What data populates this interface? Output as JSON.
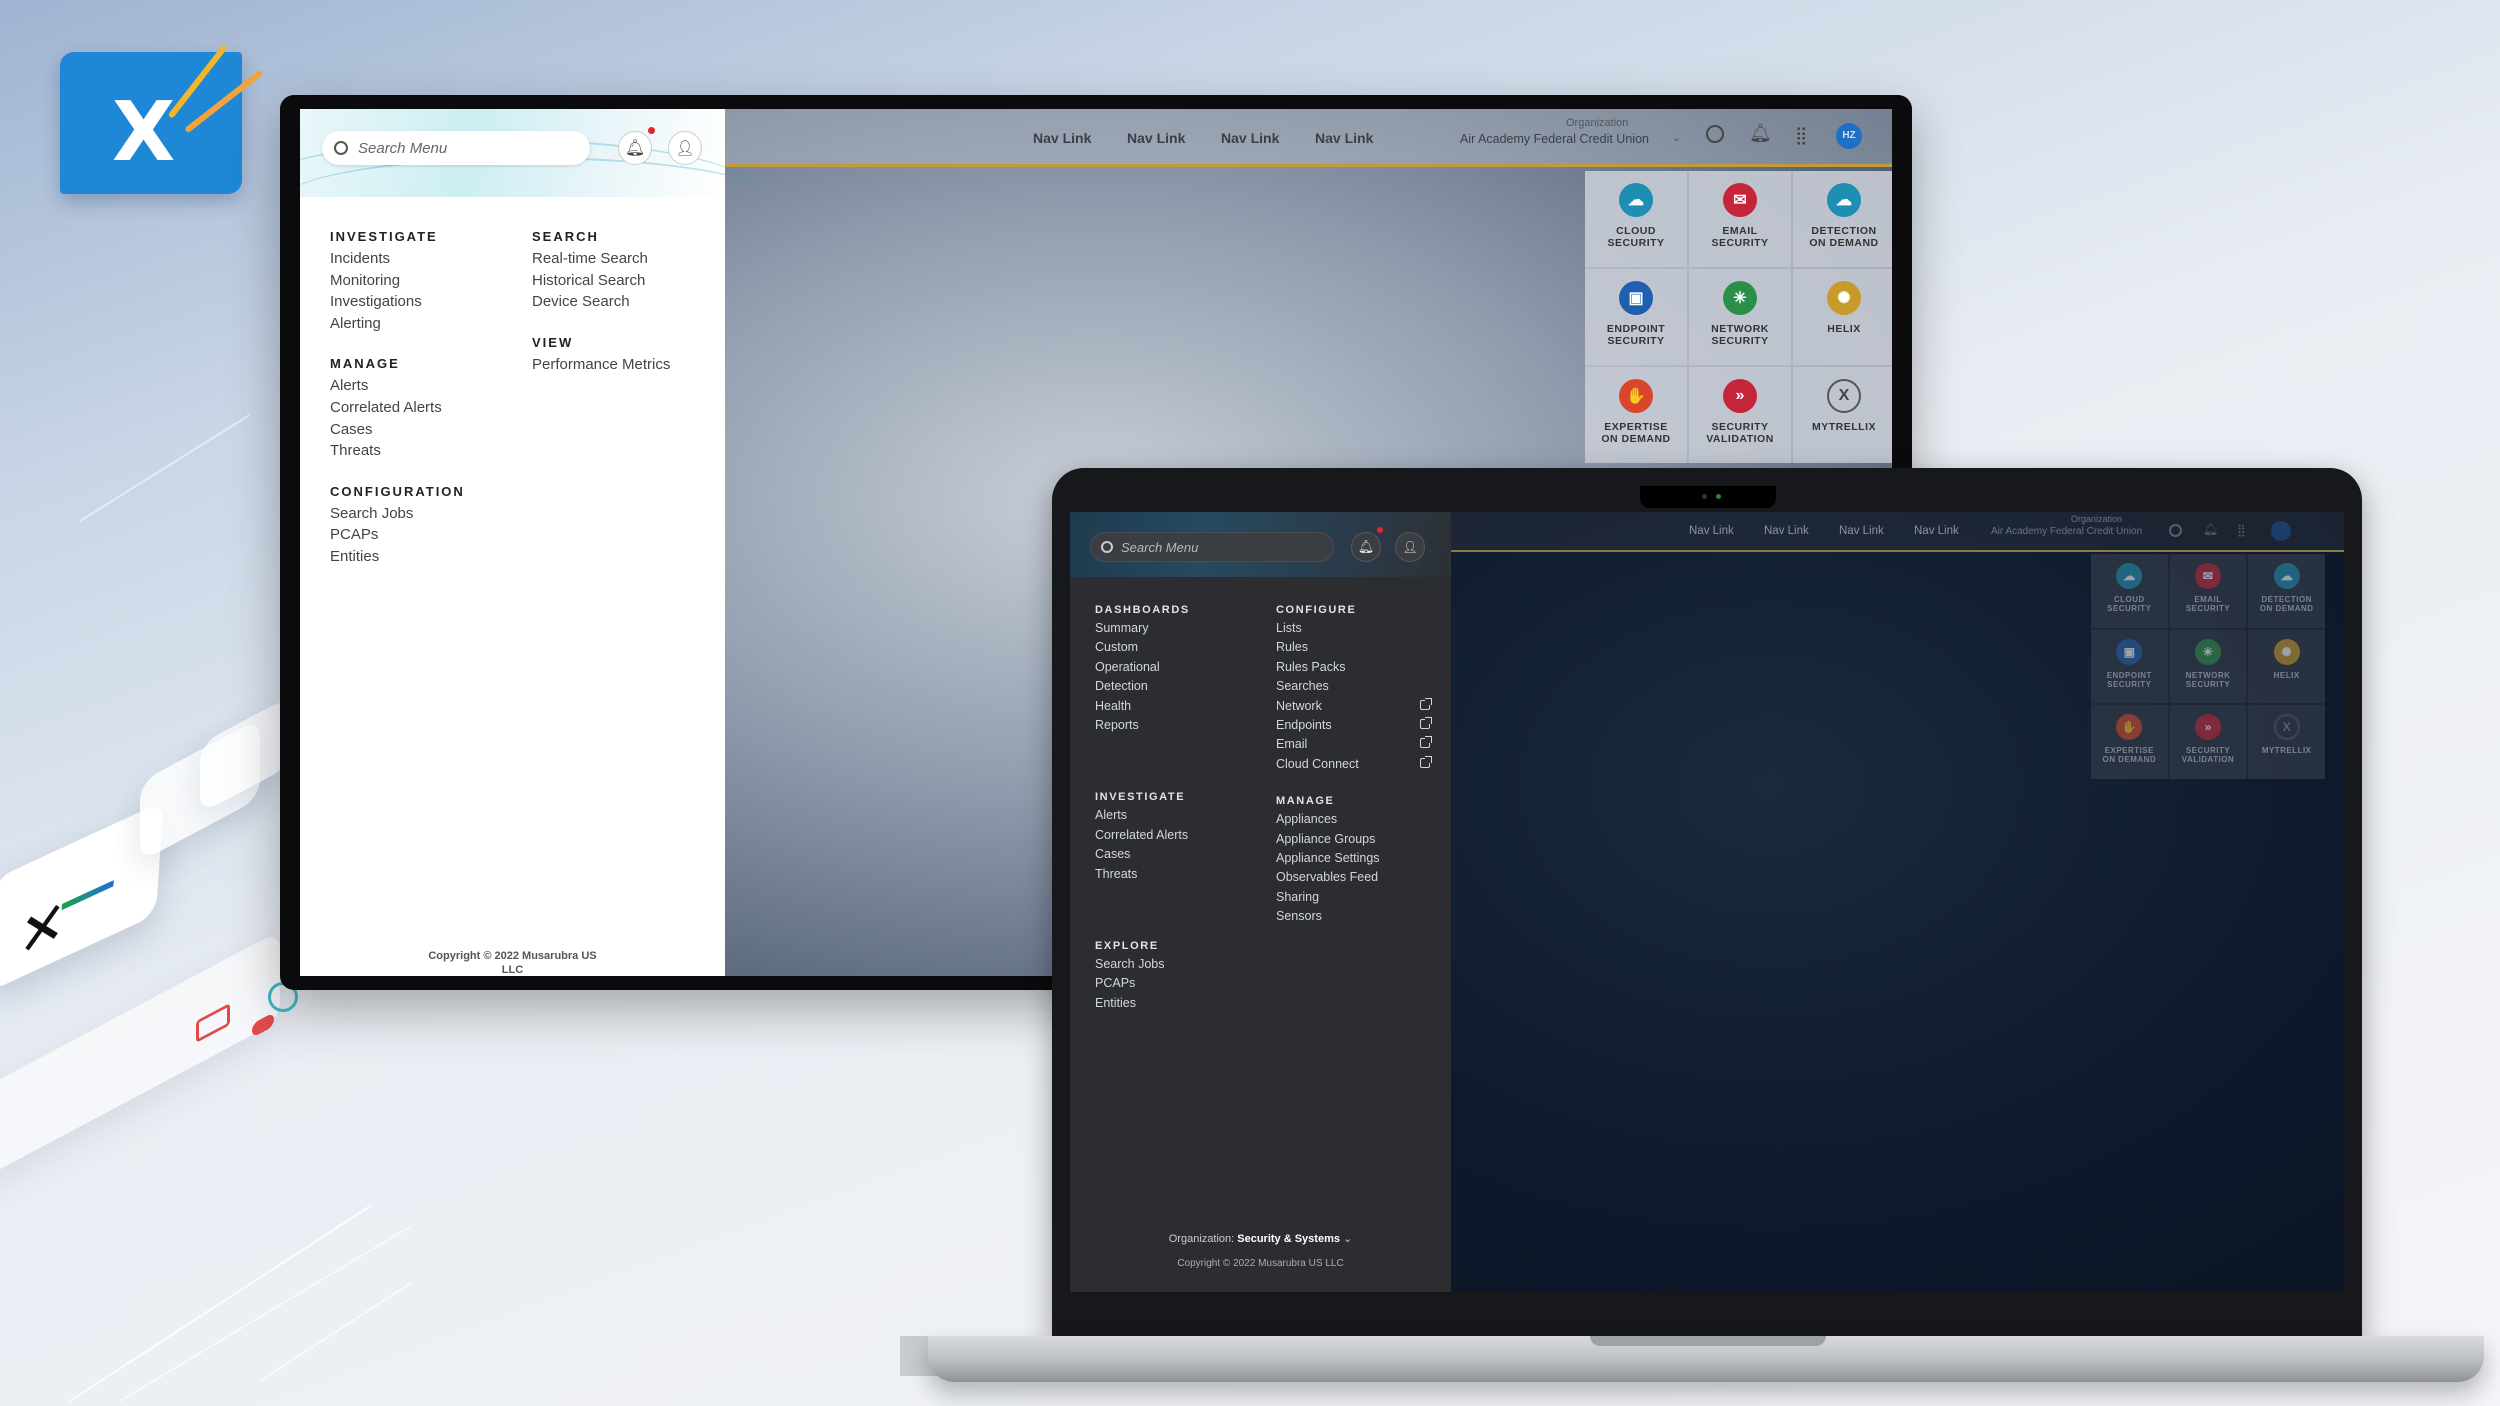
{
  "monitor": {
    "search_placeholder": "Search Menu",
    "menu": {
      "left": [
        {
          "title": "INVESTIGATE",
          "items": [
            "Incidents",
            "Monitoring",
            "Investigations",
            "Alerting"
          ]
        },
        {
          "title": "MANAGE",
          "items": [
            "Alerts",
            "Correlated Alerts",
            "Cases",
            "Threats"
          ]
        },
        {
          "title": "CONFIGURATION",
          "items": [
            "Search Jobs",
            "PCAPs",
            "Entities"
          ]
        }
      ],
      "right": [
        {
          "title": "SEARCH",
          "items": [
            "Real-time Search",
            "Historical Search",
            "Device Search"
          ]
        },
        {
          "title": "VIEW",
          "items": [
            "Performance Metrics"
          ]
        }
      ]
    },
    "copyright_1": "Copyright © 2022 Musarubra US",
    "copyright_2": "LLC",
    "nav_links": [
      "Nav Link",
      "Nav Link",
      "Nav Link",
      "Nav Link"
    ],
    "org_label": "Organization",
    "org_value": "Air Academy Federal Credit Union",
    "avatar_initials": "HZ",
    "tiles": [
      {
        "l1": "CLOUD",
        "l2": "SECURITY",
        "color": "#1e8fb3",
        "glyph": "☁"
      },
      {
        "l1": "EMAIL",
        "l2": "SECURITY",
        "color": "#c4253b",
        "glyph": "✉"
      },
      {
        "l1": "DETECTION",
        "l2": "ON DEMAND",
        "color": "#1e8fb3",
        "glyph": "☁"
      },
      {
        "l1": "ENDPOINT",
        "l2": "SECURITY",
        "color": "#1f5fb0",
        "glyph": "▣"
      },
      {
        "l1": "NETWORK",
        "l2": "SECURITY",
        "color": "#2b8f4a",
        "glyph": "✳"
      },
      {
        "l1": "HELIX",
        "l2": "",
        "color": "#c79a2b",
        "glyph": "✺"
      },
      {
        "l1": "EXPERTISE",
        "l2": "ON DEMAND",
        "color": "#d9462b",
        "glyph": "✋"
      },
      {
        "l1": "SECURITY",
        "l2": "VALIDATION",
        "color": "#c4253b",
        "glyph": "»"
      },
      {
        "l1": "MYTRELLIX",
        "l2": "",
        "color": "#4a4f57",
        "glyph": "X"
      }
    ]
  },
  "laptop": {
    "search_placeholder": "Search Menu",
    "menu": {
      "left": [
        {
          "title": "DASHBOARDS",
          "items": [
            "Summary",
            "Custom",
            "Operational",
            "Detection",
            "Health",
            "Reports"
          ]
        },
        {
          "title": "INVESTIGATE",
          "items": [
            "Alerts",
            "Correlated Alerts",
            "Cases",
            "Threats"
          ]
        },
        {
          "title": "EXPLORE",
          "items": [
            "Search Jobs",
            "PCAPs",
            "Entities"
          ]
        }
      ],
      "right": [
        {
          "title": "CONFIGURE",
          "items": [
            "Lists",
            "Rules",
            "Rules Packs",
            "Searches",
            "Network",
            "Endpoints",
            "Email",
            "Cloud Connect"
          ]
        },
        {
          "title": "MANAGE",
          "items": [
            "Appliances",
            "Appliance Groups",
            "Appliance Settings",
            "Observables Feed",
            "Sharing",
            "Sensors"
          ]
        }
      ]
    },
    "org_prefix": "Organization:",
    "org_value": "Security & Systems",
    "copyright": "Copyright © 2022 Musarubra US LLC",
    "nav_links": [
      "Nav Link",
      "Nav Link",
      "Nav Link",
      "Nav Link"
    ],
    "org_label": "Organization",
    "org_value_top": "Air Academy Federal Credit Union"
  },
  "colors": {
    "accent_gold": "#c29a3a",
    "notification": "#e3262e",
    "brand_blue": "#1e88d6"
  }
}
